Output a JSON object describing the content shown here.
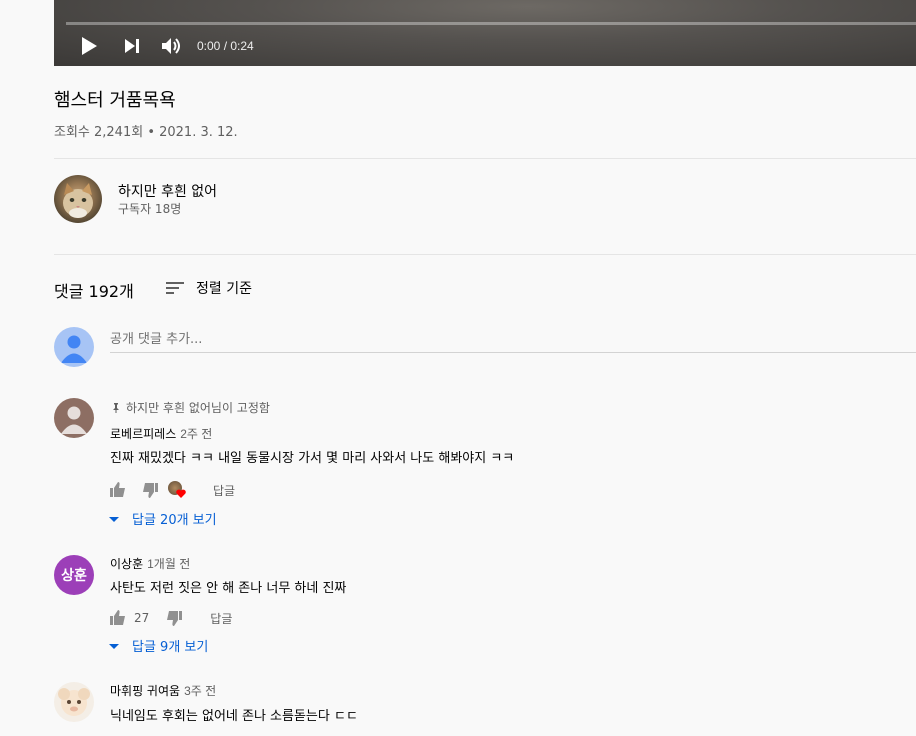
{
  "player": {
    "time": "0:00 / 0:24",
    "progress": 0
  },
  "video": {
    "title": "햄스터 거품목욕",
    "meta": "조회수 2,241회 • 2021. 3. 12."
  },
  "channel": {
    "name": "하지만 후흰 없어",
    "subscribers": "구독자 18명"
  },
  "comments_header": {
    "count": "댓글 192개",
    "sort_label": "정렬 기준"
  },
  "add_comment": {
    "placeholder": "공개 댓글 추가..."
  },
  "comments": [
    {
      "pinned": "하지만 후흰 없어님이 고정함",
      "author": "로베르피레스",
      "time": "2주 전",
      "text": "진짜 재밌겠다 ㅋㅋ 내일 동물시장 가서 몇 마리 사와서 나도 해봐야지 ㅋㅋ",
      "likes": "",
      "reply_label": "답글",
      "view_replies": "답글 20개 보기"
    },
    {
      "avatar_text": "상훈",
      "author": "이상훈",
      "time": "1개월 전",
      "text": "사탄도 저런 짓은 안 해 존나 너무 하네 진짜",
      "likes": "27",
      "reply_label": "답글",
      "view_replies": "답글 9개 보기"
    },
    {
      "author": "마휘핑 귀여움",
      "time": "3주 전",
      "text": "닉네임도 후회는 없어네 존나 소름돋는다 ㄷㄷ"
    }
  ],
  "colors": {
    "accent_blue": "#065fd4",
    "avatar_purple": "#9c3fb8",
    "heart_red": "#ff0000"
  }
}
